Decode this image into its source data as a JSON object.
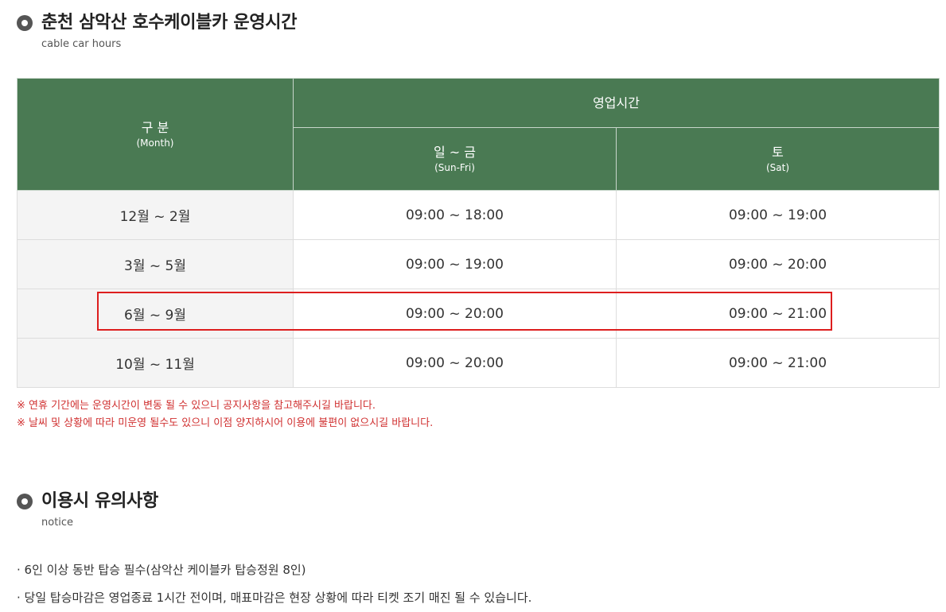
{
  "section1": {
    "title": "춘천 삼악산 호수케이블카 운영시간",
    "subtitle": "cable car hours"
  },
  "table": {
    "header": {
      "category_ko": "구 분",
      "category_en": "(Month)",
      "hours_ko": "영업시간",
      "weekday_ko": "일 ~ 금",
      "weekday_en": "(Sun-Fri)",
      "saturday_ko": "토",
      "saturday_en": "(Sat)"
    },
    "rows": [
      {
        "month": "12월 ~ 2월",
        "weekday": "09:00 ~ 18:00",
        "saturday": "09:00 ~ 19:00"
      },
      {
        "month": "3월 ~ 5월",
        "weekday": "09:00 ~ 19:00",
        "saturday": "09:00 ~ 20:00"
      },
      {
        "month": "6월 ~ 9월",
        "weekday": "09:00 ~ 20:00",
        "saturday": "09:00 ~ 21:00"
      },
      {
        "month": "10월 ~ 11월",
        "weekday": "09:00 ~ 20:00",
        "saturday": "09:00 ~ 21:00"
      }
    ]
  },
  "notes": [
    "※ 연휴 기간에는 운영시간이 변동 될 수 있으니 공지사항을 참고해주시길 바랍니다.",
    "※ 날씨 및 상황에 따라 미운영 될수도 있으니 이점 양지하시어 이용에 불편이 없으시길 바랍니다."
  ],
  "section2": {
    "title": "이용시 유의사항",
    "subtitle": "notice"
  },
  "notice_items": [
    "6인 이상 동반 탑승 필수(삼악산 케이블카 탑승정원 8인)",
    "당일 탑승마감은 영업종료 1시간 전이며, 매표마감은 현장 상황에 따라 티켓 조기 매진 될 수 있습니다."
  ],
  "colors": {
    "header_bg": "#4a7a53",
    "note_red": "#d03030",
    "highlight_red": "#dd1e1e"
  }
}
